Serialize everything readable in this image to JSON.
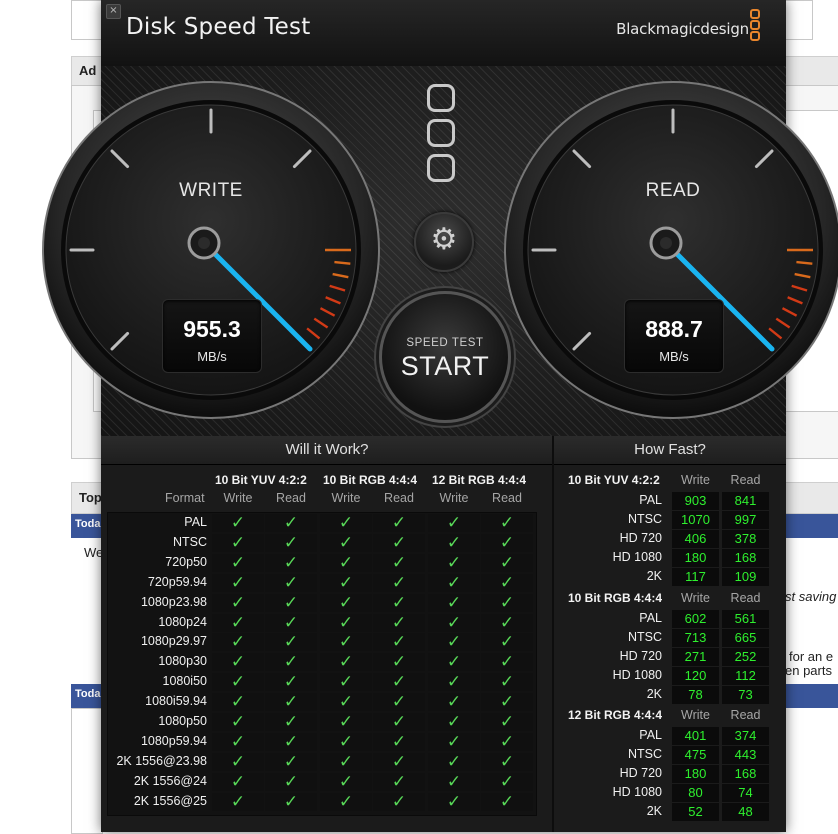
{
  "window": {
    "title": "Disk Speed Test",
    "brand": "Blackmagicdesign",
    "close_symbol": "×"
  },
  "background": {
    "fragments": [
      "Ad",
      "Top",
      "Toda",
      "We",
      "Toda",
      "st saving",
      "for an e",
      "en parts"
    ]
  },
  "gauges": {
    "write": {
      "label": "WRITE",
      "value": "955.3",
      "unit": "MB/s"
    },
    "read": {
      "label": "READ",
      "value": "888.7",
      "unit": "MB/s"
    }
  },
  "start_button": {
    "small_label": "SPEED TEST",
    "big_label": "START"
  },
  "settings_icon": "gear-icon",
  "will_it_work": {
    "title": "Will it Work?",
    "format_label": "Format",
    "groups": [
      "10 Bit YUV 4:2:2",
      "10 Bit RGB 4:4:4",
      "12 Bit RGB 4:4:4"
    ],
    "sub_labels": [
      "Write",
      "Read"
    ],
    "check_symbol": "✓",
    "rows": [
      "PAL",
      "NTSC",
      "720p50",
      "720p59.94",
      "1080p23.98",
      "1080p24",
      "1080p29.97",
      "1080p30",
      "1080i50",
      "1080i59.94",
      "1080p50",
      "1080p59.94",
      "2K 1556@23.98",
      "2K 1556@24",
      "2K 1556@25"
    ]
  },
  "how_fast": {
    "title": "How Fast?",
    "sub_labels": [
      "Write",
      "Read"
    ],
    "groups": [
      {
        "name": "10 Bit YUV 4:2:2",
        "rows": [
          {
            "label": "PAL",
            "write": "903",
            "read": "841"
          },
          {
            "label": "NTSC",
            "write": "1070",
            "read": "997"
          },
          {
            "label": "HD 720",
            "write": "406",
            "read": "378"
          },
          {
            "label": "HD 1080",
            "write": "180",
            "read": "168"
          },
          {
            "label": "2K",
            "write": "117",
            "read": "109"
          }
        ]
      },
      {
        "name": "10 Bit RGB 4:4:4",
        "rows": [
          {
            "label": "PAL",
            "write": "602",
            "read": "561"
          },
          {
            "label": "NTSC",
            "write": "713",
            "read": "665"
          },
          {
            "label": "HD 720",
            "write": "271",
            "read": "252"
          },
          {
            "label": "HD 1080",
            "write": "120",
            "read": "112"
          },
          {
            "label": "2K",
            "write": "78",
            "read": "73"
          }
        ]
      },
      {
        "name": "12 Bit RGB 4:4:4",
        "rows": [
          {
            "label": "PAL",
            "write": "401",
            "read": "374"
          },
          {
            "label": "NTSC",
            "write": "475",
            "read": "443"
          },
          {
            "label": "HD 720",
            "write": "180",
            "read": "168"
          },
          {
            "label": "HD 1080",
            "write": "80",
            "read": "74"
          },
          {
            "label": "2K",
            "write": "52",
            "read": "48"
          }
        ]
      }
    ]
  },
  "colors": {
    "accent_orange": "#e8852c",
    "needle_blue": "#1ab4f0",
    "value_green": "#2ef02e",
    "check_green": "#58d858",
    "redline": "#d23a16"
  }
}
